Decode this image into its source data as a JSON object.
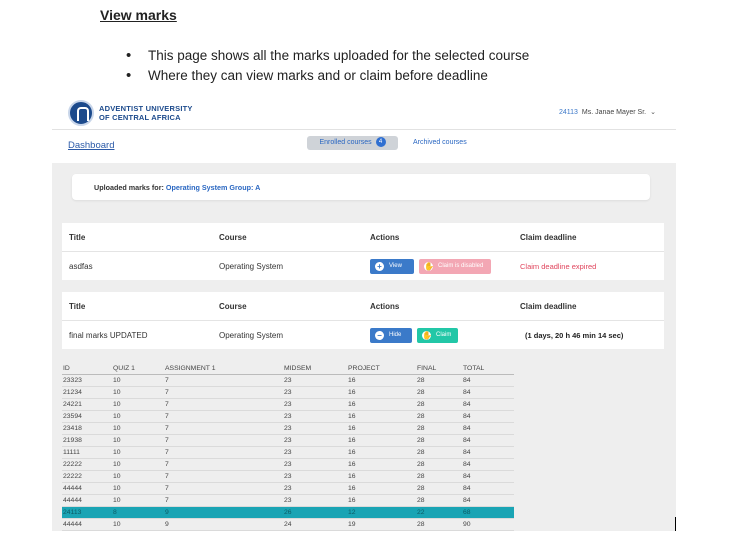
{
  "doc": {
    "heading": "View marks",
    "bullets": [
      "This page shows all the marks uploaded for the selected course",
      "Where they can view marks and or claim before deadline"
    ]
  },
  "header": {
    "logo_line1": "ADVENTIST UNIVERSITY",
    "logo_line2": "OF CENTRAL AFRICA",
    "user_id": "24113",
    "user_name": "Ms. Janae Mayer Sr.",
    "user_menu_icon": "chevron-down-icon"
  },
  "nav": {
    "dashboard_label": "Dashboard",
    "enrolled_label": "Enrolled courses",
    "enrolled_count": "4",
    "archived_label": "Archived courses"
  },
  "uploaded": {
    "label": "Uploaded marks for:",
    "course": "Operating System Group: A"
  },
  "cards": [
    {
      "headers": {
        "title": "Title",
        "course": "Course",
        "actions": "Actions",
        "deadline": "Claim deadline"
      },
      "title": "asdfas",
      "course": "Operating System",
      "primary_button": "View",
      "primary_icon": "plus-circle-icon",
      "secondary_button": "Claim is disabled",
      "secondary_icon": "hand-icon",
      "deadline_text": "Claim deadline expired"
    },
    {
      "headers": {
        "title": "Title",
        "course": "Course",
        "actions": "Actions",
        "deadline": "Claim deadline"
      },
      "title": "final marks UPDATED",
      "course": "Operating System",
      "primary_button": "Hide",
      "primary_icon": "minus-circle-icon",
      "secondary_button": "Claim",
      "secondary_icon": "hand-icon",
      "deadline_text": "(1 days, 20 h 46 min 14 sec)"
    }
  ],
  "colors": {
    "accent": "#3b7ac9",
    "danger": "#e0455d",
    "success": "#22c7a7",
    "highlight_row": "#1aa4b4"
  },
  "marks": {
    "columns": [
      "ID",
      "QUIZ 1",
      "ASSIGNMENT 1",
      "MIDSEM",
      "PROJECT",
      "FINAL",
      "TOTAL"
    ],
    "rows": [
      [
        "23323",
        "10",
        "7",
        "23",
        "16",
        "28",
        "84"
      ],
      [
        "21234",
        "10",
        "7",
        "23",
        "16",
        "28",
        "84"
      ],
      [
        "24221",
        "10",
        "7",
        "23",
        "16",
        "28",
        "84"
      ],
      [
        "23594",
        "10",
        "7",
        "23",
        "16",
        "28",
        "84"
      ],
      [
        "23418",
        "10",
        "7",
        "23",
        "16",
        "28",
        "84"
      ],
      [
        "21938",
        "10",
        "7",
        "23",
        "16",
        "28",
        "84"
      ],
      [
        "11111",
        "10",
        "7",
        "23",
        "16",
        "28",
        "84"
      ],
      [
        "22222",
        "10",
        "7",
        "23",
        "16",
        "28",
        "84"
      ],
      [
        "22222",
        "10",
        "7",
        "23",
        "16",
        "28",
        "84"
      ],
      [
        "44444",
        "10",
        "7",
        "23",
        "16",
        "28",
        "84"
      ],
      [
        "44444",
        "10",
        "7",
        "23",
        "16",
        "28",
        "84"
      ],
      [
        "24113",
        "8",
        "9",
        "26",
        "12",
        "22",
        "68"
      ],
      [
        "44444",
        "10",
        "9",
        "24",
        "19",
        "28",
        "90"
      ]
    ],
    "highlight_index": 11
  }
}
